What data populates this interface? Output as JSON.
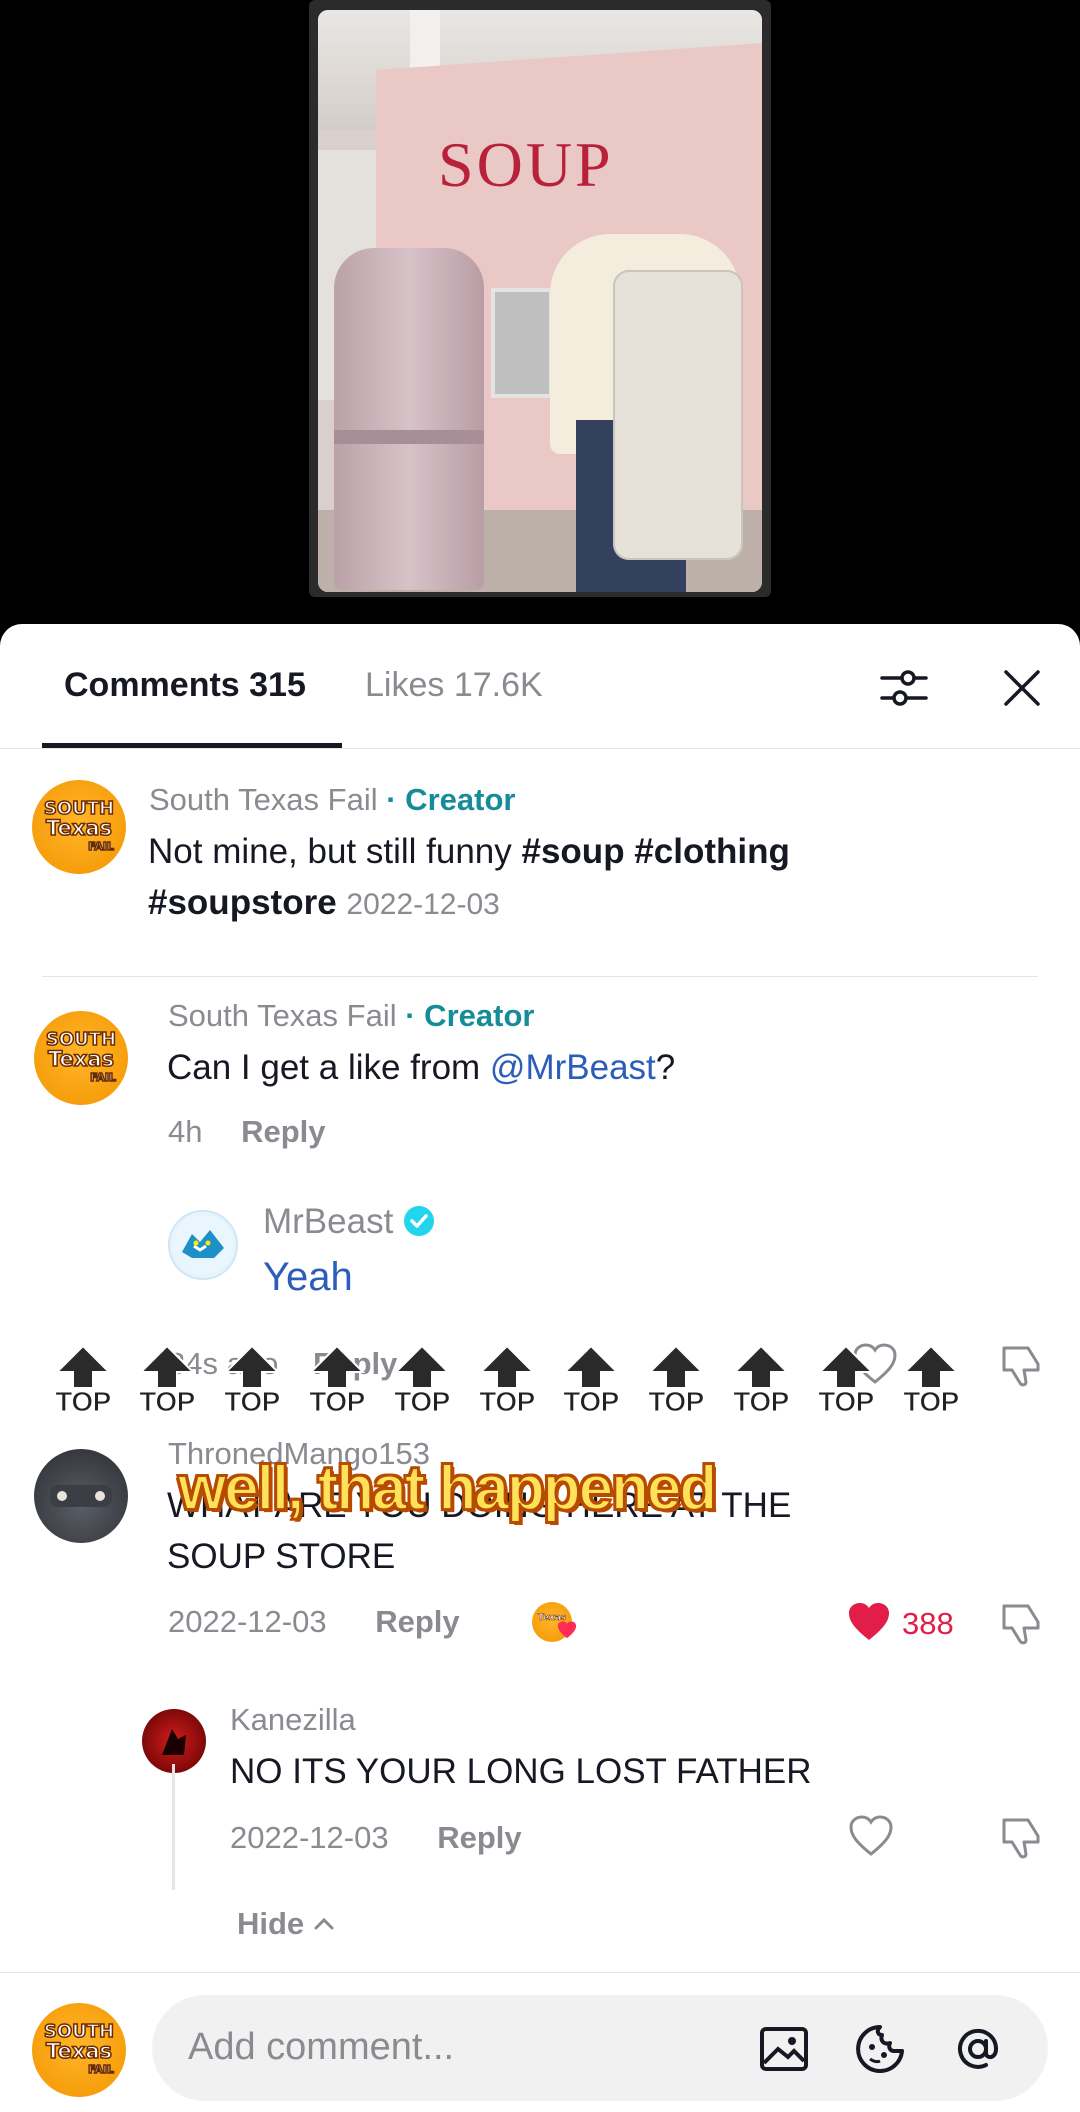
{
  "video": {
    "store_sign": "SOUP"
  },
  "tabs": {
    "comments_label": "Comments 315",
    "likes_label": "Likes 17.6K",
    "active": "comments"
  },
  "caption_comment": {
    "author": "South Texas Fail",
    "creator_badge": "· Creator",
    "text_plain": "Not mine, but still funny ",
    "hashtags_line1": "#soup #clothing",
    "hashtag_line2": "#soupstore",
    "date": "2022-12-03"
  },
  "comments": [
    {
      "author": "South Texas Fail",
      "creator_badge": "· Creator",
      "text_before": "Can I get a like from ",
      "mention": "@MrBeast",
      "text_after": "?",
      "time": "4h",
      "reply_label": "Reply",
      "reply": {
        "author": "MrBeast",
        "verified": true,
        "text": "Yeah",
        "time": "34s ago",
        "reply_label": "Reply"
      }
    },
    {
      "author": "ThronedMango153",
      "text_line1": "WHAT ARE YOU DOING HERE AT THE",
      "text_line2": "SOUP STORE",
      "date": "2022-12-03",
      "reply_label": "Reply",
      "likes": "388",
      "liked": true,
      "reply": {
        "author": "Kanezilla",
        "text": "NO ITS YOUR LONG LOST FATHER",
        "date": "2022-12-03",
        "reply_label": "Reply"
      },
      "hide_label": "Hide"
    }
  ],
  "overlay": {
    "top_label": "TOP",
    "caption": "well, that happened"
  },
  "avatar_text": {
    "line1": "SOUTH",
    "line2": "Texas",
    "line3": "FAIL"
  },
  "composer": {
    "placeholder": "Add comment..."
  },
  "colors": {
    "creator": "#168c99",
    "mention": "#2b5db9",
    "like": "#e11d48",
    "caption_fill": "#ffe15a",
    "caption_stroke": "#b74b00"
  }
}
